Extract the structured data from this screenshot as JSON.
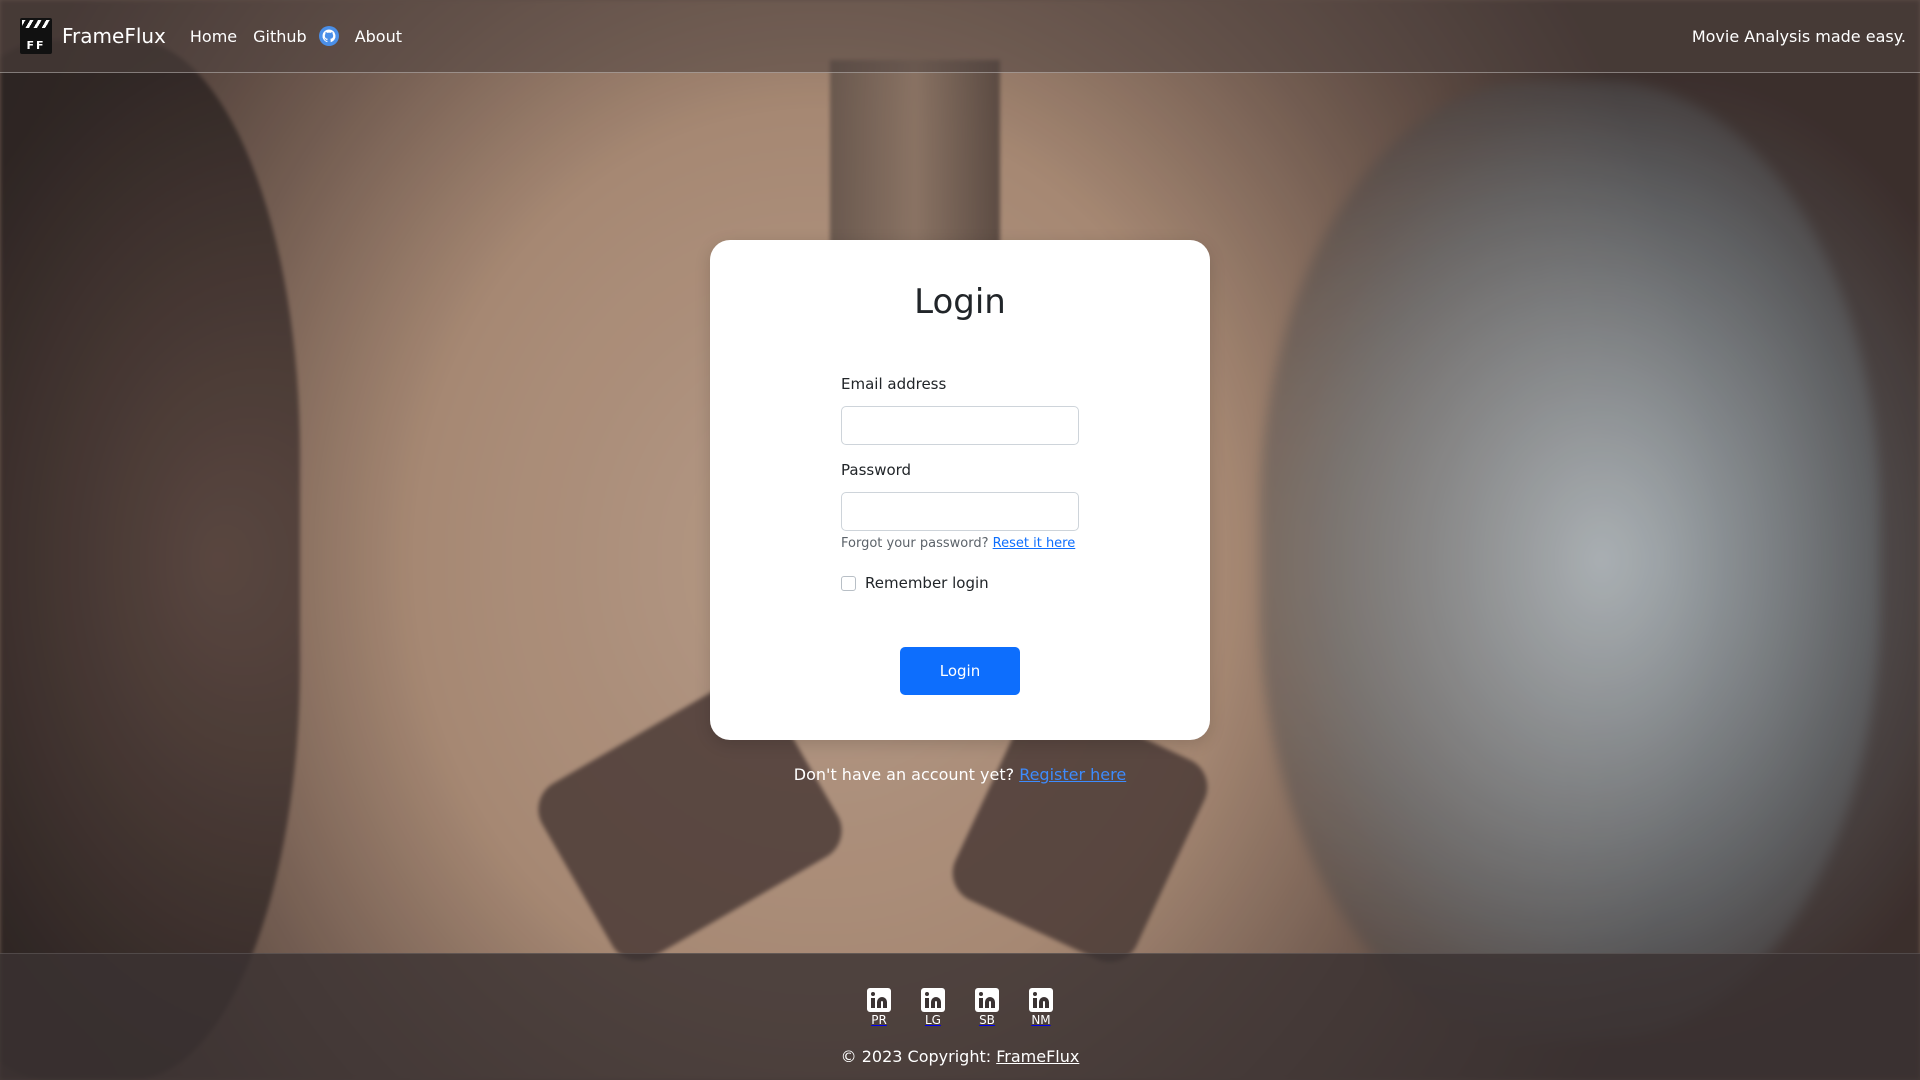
{
  "navbar": {
    "brand": "FrameFlux",
    "logo_text": "FF",
    "links": [
      "Home",
      "Github",
      "About"
    ],
    "github_icon": "github-icon",
    "tagline": "Movie Analysis made easy."
  },
  "login_card": {
    "title": "Login",
    "email_label": "Email address",
    "email_value": "",
    "password_label": "Password",
    "password_value": "",
    "forgot_text": "Forgot your password?",
    "reset_link": "Reset it here",
    "remember_label": "Remember login",
    "remember_checked": false,
    "submit_label": "Login"
  },
  "register": {
    "text": "Don't have an account yet?",
    "link": "Register here"
  },
  "footer": {
    "socials": [
      {
        "icon": "linkedin-icon",
        "label": "PR"
      },
      {
        "icon": "linkedin-icon",
        "label": "LG"
      },
      {
        "icon": "linkedin-icon",
        "label": "SB"
      },
      {
        "icon": "linkedin-icon",
        "label": "NM"
      }
    ],
    "copyright_text": "© 2023 Copyright:",
    "copyright_link": "FrameFlux"
  },
  "colors": {
    "primary": "#0d6efd",
    "link": "#3d8bfd",
    "github_icon": "#4a8fe8"
  }
}
